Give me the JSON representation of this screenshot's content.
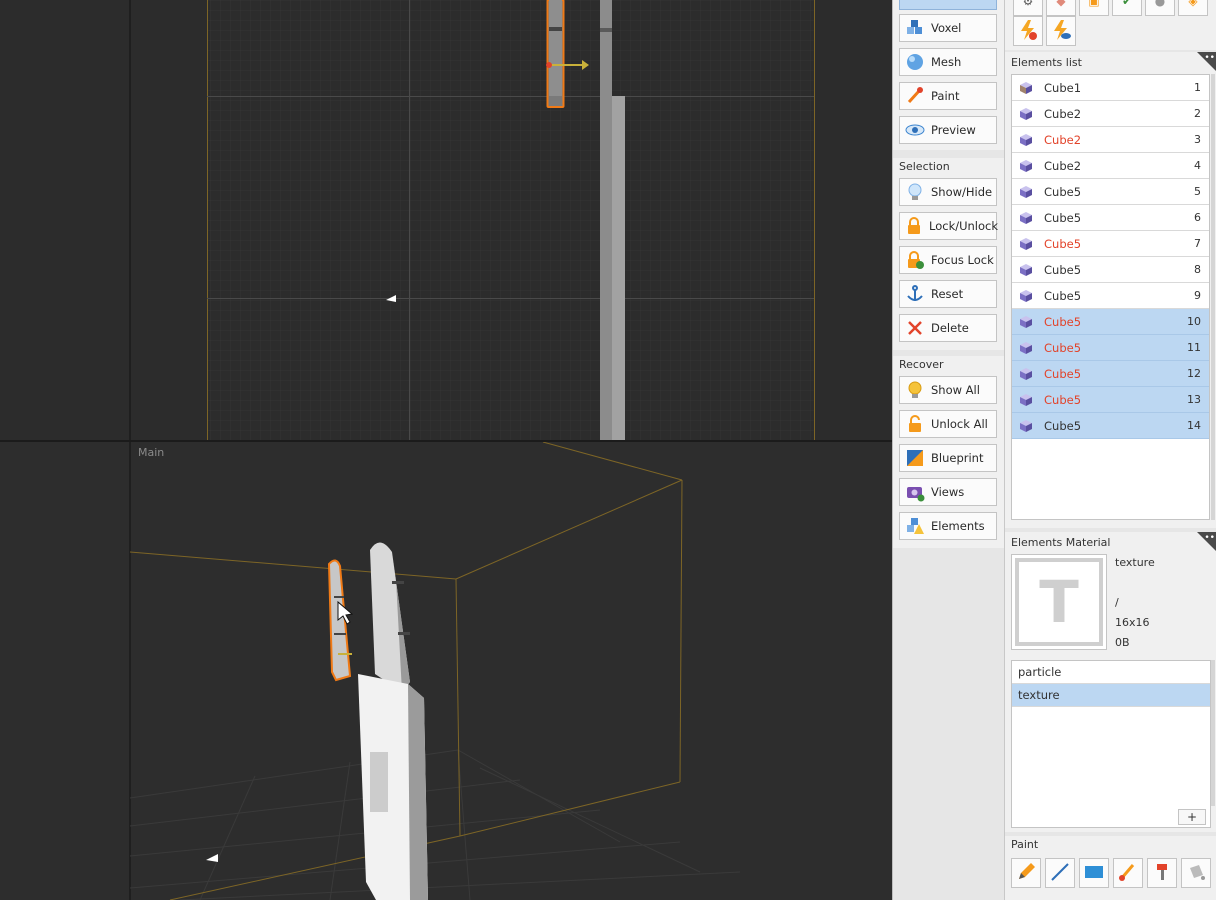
{
  "viewport": {
    "main_label": "Main"
  },
  "toolbar": {
    "modes": [
      {
        "label": "Voxel",
        "icon": "voxel-icon"
      },
      {
        "label": "Mesh",
        "icon": "mesh-sphere-icon"
      },
      {
        "label": "Paint",
        "icon": "paint-brush-icon"
      },
      {
        "label": "Preview",
        "icon": "preview-eye-icon"
      }
    ],
    "selection": {
      "title": "Selection",
      "items": [
        {
          "label": "Show/Hide",
          "icon": "lightbulb-icon"
        },
        {
          "label": "Lock/Unlock",
          "icon": "padlock-icon"
        },
        {
          "label": "Focus Lock",
          "icon": "focus-lock-icon"
        },
        {
          "label": "Reset",
          "icon": "anchor-icon"
        },
        {
          "label": "Delete",
          "icon": "delete-x-icon"
        }
      ]
    },
    "recover": {
      "title": "Recover",
      "items": [
        {
          "label": "Show All",
          "icon": "lightbulb-icon"
        },
        {
          "label": "Unlock All",
          "icon": "padlock-icon"
        },
        {
          "label": "Blueprint",
          "icon": "blueprint-icon"
        },
        {
          "label": "Views",
          "icon": "camera-icon"
        },
        {
          "label": "Elements",
          "icon": "elements-warning-icon"
        }
      ]
    }
  },
  "elements_list": {
    "title": "Elements list",
    "items": [
      {
        "name": "Cube1",
        "index": "1",
        "red": false,
        "selected": false,
        "icon_color": "#a0826d"
      },
      {
        "name": "Cube2",
        "index": "2",
        "red": false,
        "selected": false,
        "icon_color": "#7b6fc4"
      },
      {
        "name": "Cube2",
        "index": "3",
        "red": true,
        "selected": false,
        "icon_color": "#7b6fc4"
      },
      {
        "name": "Cube2",
        "index": "4",
        "red": false,
        "selected": false,
        "icon_color": "#7b6fc4"
      },
      {
        "name": "Cube5",
        "index": "5",
        "red": false,
        "selected": false,
        "icon_color": "#7b6fc4"
      },
      {
        "name": "Cube5",
        "index": "6",
        "red": false,
        "selected": false,
        "icon_color": "#7b6fc4"
      },
      {
        "name": "Cube5",
        "index": "7",
        "red": true,
        "selected": false,
        "icon_color": "#7b6fc4"
      },
      {
        "name": "Cube5",
        "index": "8",
        "red": false,
        "selected": false,
        "icon_color": "#7b6fc4"
      },
      {
        "name": "Cube5",
        "index": "9",
        "red": false,
        "selected": false,
        "icon_color": "#7b6fc4"
      },
      {
        "name": "Cube5",
        "index": "10",
        "red": true,
        "selected": true,
        "icon_color": "#7b6fc4"
      },
      {
        "name": "Cube5",
        "index": "11",
        "red": true,
        "selected": true,
        "icon_color": "#7b6fc4"
      },
      {
        "name": "Cube5",
        "index": "12",
        "red": true,
        "selected": true,
        "icon_color": "#7b6fc4"
      },
      {
        "name": "Cube5",
        "index": "13",
        "red": true,
        "selected": true,
        "icon_color": "#7b6fc4"
      },
      {
        "name": "Cube5",
        "index": "14",
        "red": false,
        "selected": true,
        "icon_color": "#7b6fc4"
      }
    ]
  },
  "elements_material": {
    "title": "Elements Material",
    "thumb_letter": "T",
    "name": "texture",
    "path": "/",
    "size": "16x16",
    "bytes": "0B",
    "materials": [
      {
        "name": "particle",
        "selected": false
      },
      {
        "name": "texture",
        "selected": true
      }
    ],
    "add_label": "+"
  },
  "paint": {
    "title": "Paint"
  },
  "colors": {
    "selection_blue": "#bcd7f2",
    "accent_orange": "#f07a16",
    "red_text": "#e2432a",
    "guide_yellow": "#8a7020"
  }
}
